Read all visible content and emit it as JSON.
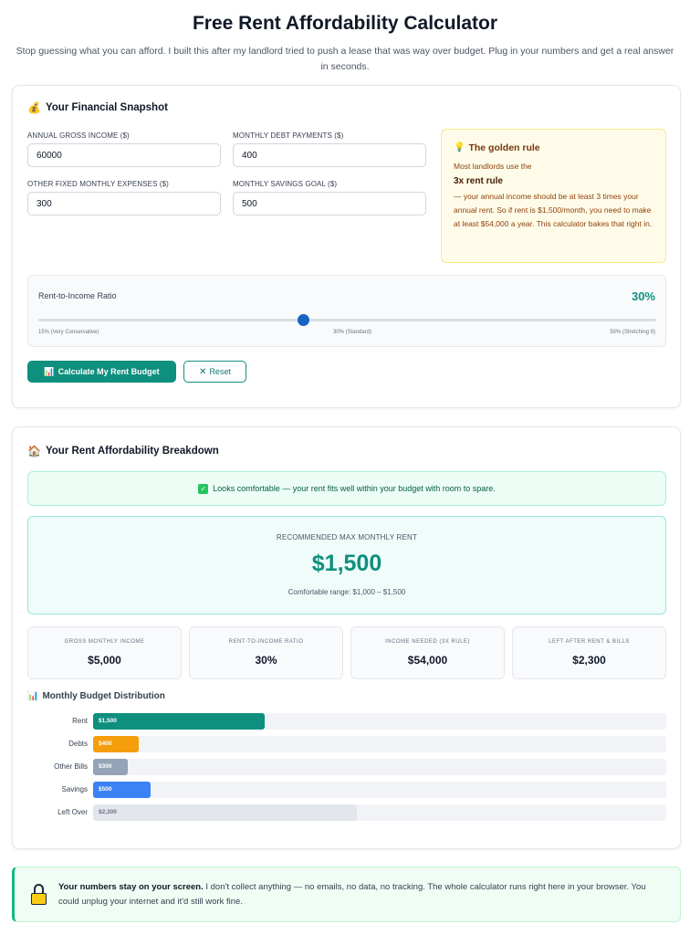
{
  "header": {
    "title": "Free Rent Affordability Calculator",
    "subtitle": "Stop guessing what you can afford. I built this after my landlord tried to push a lease that was way over budget. Plug in your numbers and get a real answer in seconds."
  },
  "snapshot": {
    "title": "Your Financial Snapshot",
    "icon": "money-bag-icon",
    "fields": {
      "annual_income": {
        "label": "ANNUAL GROSS INCOME ($)",
        "value": "60000"
      },
      "monthly_debt": {
        "label": "MONTHLY DEBT PAYMENTS ($)",
        "value": "400"
      },
      "other_expenses": {
        "label": "OTHER FIXED MONTHLY EXPENSES ($)",
        "value": "300"
      },
      "savings_goal": {
        "label": "MONTHLY SAVINGS GOAL ($)",
        "value": "500"
      }
    },
    "tip": {
      "title": "The golden rule",
      "line1": "Most landlords use the",
      "strong": "3x rent rule",
      "line2": "— your annual income should be at least 3 times your annual rent. So if rent is $1,500/month, you need to make at least $54,000 a year. This calculator bakes that right in."
    },
    "slider": {
      "label": "Rent-to-Income Ratio",
      "value_text": "30%",
      "min": 15,
      "max": 50,
      "value": 30,
      "ticks": {
        "min": "15% (Very Conservative)",
        "mid": "30% (Standard)",
        "max": "50% (Stretching It)"
      }
    },
    "buttons": {
      "calculate": "Calculate My Rent Budget",
      "reset": "Reset"
    }
  },
  "breakdown": {
    "title": "Your Rent Affordability Breakdown",
    "icon": "house-icon",
    "status": "Looks comfortable — your rent fits well within your budget with room to spare.",
    "recommended": {
      "label": "RECOMMENDED MAX MONTHLY RENT",
      "value": "$1,500",
      "range": "Comfortable range: $1,000 – $1,500"
    },
    "stats": [
      {
        "label": "Gross Monthly Income",
        "value": "$5,000"
      },
      {
        "label": "Rent-to-Income Ratio",
        "value": "30%"
      },
      {
        "label": "Income Needed (3x Rule)",
        "value": "$54,000"
      },
      {
        "label": "Left After Rent & Bills",
        "value": "$2,300"
      }
    ],
    "distribution": {
      "title": "Monthly Budget Distribution",
      "total": 5000,
      "bars": [
        {
          "label": "Rent",
          "amount": 1500,
          "text": "$1,500",
          "color": "#0f8f7e"
        },
        {
          "label": "Debts",
          "amount": 400,
          "text": "$400",
          "color": "#f59e0b"
        },
        {
          "label": "Other Bills",
          "amount": 300,
          "text": "$300",
          "color": "#94a3b8"
        },
        {
          "label": "Savings",
          "amount": 500,
          "text": "$500",
          "color": "#3b82f6"
        },
        {
          "label": "Left Over",
          "amount": 2300,
          "text": "$2,300",
          "color": "#e2e6ec"
        }
      ]
    }
  },
  "privacy": {
    "bold": "Your numbers stay on your screen.",
    "text": " I don't collect anything — no emails, no data, no tracking. The whole calculator runs right here in your browser. You could unplug your internet and it'd still work fine."
  }
}
